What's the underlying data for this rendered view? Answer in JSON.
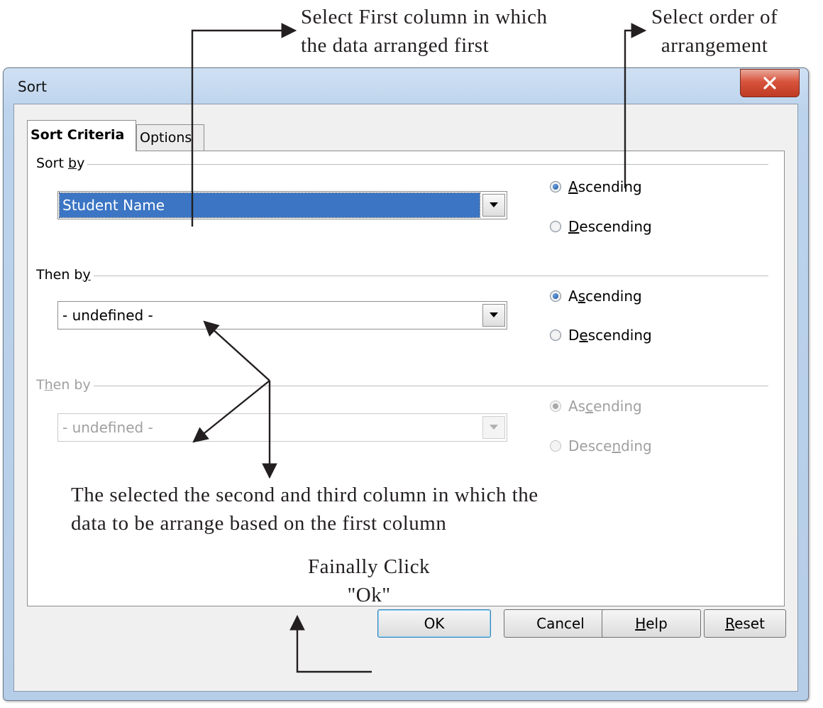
{
  "annotations": {
    "first_column_line1": "Select First column in which",
    "first_column_line2": "the data arranged first",
    "order_line1": "Select order of",
    "order_line2": "arrangement",
    "second_third_line1": "The selected the second and third column in which the",
    "second_third_line2": "data to be arrange based on the first column",
    "ok_line1": "Fainally Click",
    "ok_line2": "\"Ok\""
  },
  "dialog": {
    "title": "Sort",
    "close_symbol": "X",
    "tabs": [
      {
        "label": "Sort Criteria"
      },
      {
        "label": "Options"
      }
    ],
    "sections": [
      {
        "label_pre": "Sort ",
        "label_key": "b",
        "label_post": "y",
        "combo_value": "Student Name",
        "asc_pre": "",
        "asc_key": "A",
        "asc_post": "scending",
        "desc_pre": "",
        "desc_key": "D",
        "desc_post": "escending",
        "selected": "ascending",
        "disabled": false
      },
      {
        "label_pre": "Then b",
        "label_key": "y",
        "label_post": "",
        "combo_value": "- undefined -",
        "asc_pre": "A",
        "asc_key": "s",
        "asc_post": "cending",
        "desc_pre": "D",
        "desc_key": "e",
        "desc_post": "scending",
        "selected": "ascending",
        "disabled": false
      },
      {
        "label_pre": "T",
        "label_key": "h",
        "label_post": "en by",
        "combo_value": "- undefined -",
        "asc_pre": "As",
        "asc_key": "c",
        "asc_post": "ending",
        "desc_pre": "Desce",
        "desc_key": "n",
        "desc_post": "ding",
        "selected": "ascending",
        "disabled": true
      }
    ],
    "buttons": {
      "ok": "OK",
      "cancel": "Cancel",
      "help_key": "H",
      "help_post": "elp",
      "reset_key": "R",
      "reset_post": "eset"
    }
  },
  "colors": {
    "selection": "#3b75c4",
    "arrow": "#231f20"
  }
}
